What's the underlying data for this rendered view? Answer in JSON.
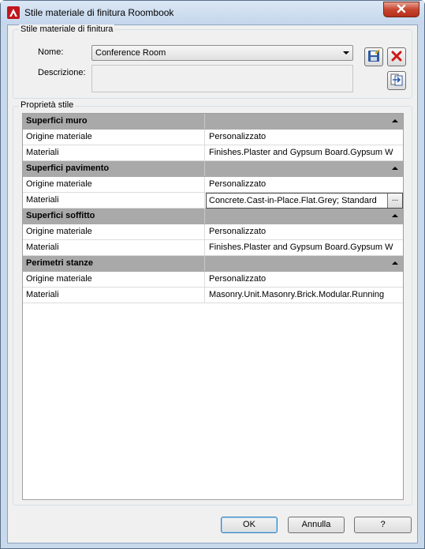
{
  "window": {
    "title": "Stile materiale di finitura Roombook",
    "app_icon": "autocad-a-icon",
    "close_icon": "close-x-icon"
  },
  "group_style": {
    "legend": "Stile materiale di finitura",
    "name_label": "Nome:",
    "name_value": "Conference Room",
    "description_label": "Descrizione:",
    "description_value": "",
    "icons": {
      "save": "save-floppy-icon",
      "delete": "delete-red-x-icon",
      "import": "import-transfer-icon"
    }
  },
  "group_properties": {
    "legend": "Proprietà stile",
    "rows": [
      {
        "type": "category",
        "name": "Superfici muro",
        "value": ""
      },
      {
        "type": "item",
        "name": "Origine materiale",
        "value": "Personalizzato"
      },
      {
        "type": "item",
        "name": "Materiali",
        "value": "Finishes.Plaster and Gypsum Board.Gypsum W"
      },
      {
        "type": "category",
        "name": "Superfici pavimento",
        "value": ""
      },
      {
        "type": "item",
        "name": "Origine materiale",
        "value": "Personalizzato"
      },
      {
        "type": "edit",
        "name": "Materiali",
        "value": "Concrete.Cast-in-Place.Flat.Grey; Standard",
        "button": "..."
      },
      {
        "type": "category",
        "name": "Superfici soffitto",
        "value": ""
      },
      {
        "type": "item",
        "name": "Origine materiale",
        "value": "Personalizzato"
      },
      {
        "type": "item",
        "name": "Materiali",
        "value": "Finishes.Plaster and Gypsum Board.Gypsum W"
      },
      {
        "type": "category",
        "name": "Perimetri stanze",
        "value": ""
      },
      {
        "type": "item",
        "name": "Origine materiale",
        "value": "Personalizzato"
      },
      {
        "type": "item",
        "name": "Materiali",
        "value": "Masonry.Unit.Masonry.Brick.Modular.Running"
      }
    ]
  },
  "buttons": {
    "ok": "OK",
    "cancel": "Annulla",
    "help": "?"
  },
  "colors": {
    "category_bg": "#a9a9a9",
    "window_frame": "#c9d9ec",
    "close_red": "#c7462f",
    "dialog_bg": "#f0f0f0"
  }
}
